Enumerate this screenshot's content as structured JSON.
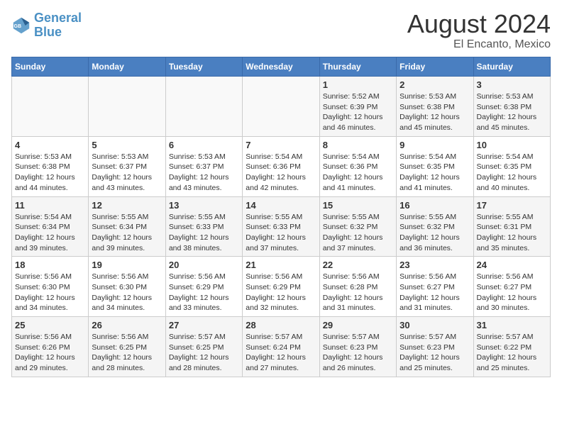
{
  "header": {
    "logo_line1": "General",
    "logo_line2": "Blue",
    "title": "August 2024",
    "subtitle": "El Encanto, Mexico"
  },
  "calendar": {
    "weekdays": [
      "Sunday",
      "Monday",
      "Tuesday",
      "Wednesday",
      "Thursday",
      "Friday",
      "Saturday"
    ],
    "weeks": [
      [
        {
          "day": "",
          "info": ""
        },
        {
          "day": "",
          "info": ""
        },
        {
          "day": "",
          "info": ""
        },
        {
          "day": "",
          "info": ""
        },
        {
          "day": "1",
          "info": "Sunrise: 5:52 AM\nSunset: 6:39 PM\nDaylight: 12 hours\nand 46 minutes."
        },
        {
          "day": "2",
          "info": "Sunrise: 5:53 AM\nSunset: 6:38 PM\nDaylight: 12 hours\nand 45 minutes."
        },
        {
          "day": "3",
          "info": "Sunrise: 5:53 AM\nSunset: 6:38 PM\nDaylight: 12 hours\nand 45 minutes."
        }
      ],
      [
        {
          "day": "4",
          "info": "Sunrise: 5:53 AM\nSunset: 6:38 PM\nDaylight: 12 hours\nand 44 minutes."
        },
        {
          "day": "5",
          "info": "Sunrise: 5:53 AM\nSunset: 6:37 PM\nDaylight: 12 hours\nand 43 minutes."
        },
        {
          "day": "6",
          "info": "Sunrise: 5:53 AM\nSunset: 6:37 PM\nDaylight: 12 hours\nand 43 minutes."
        },
        {
          "day": "7",
          "info": "Sunrise: 5:54 AM\nSunset: 6:36 PM\nDaylight: 12 hours\nand 42 minutes."
        },
        {
          "day": "8",
          "info": "Sunrise: 5:54 AM\nSunset: 6:36 PM\nDaylight: 12 hours\nand 41 minutes."
        },
        {
          "day": "9",
          "info": "Sunrise: 5:54 AM\nSunset: 6:35 PM\nDaylight: 12 hours\nand 41 minutes."
        },
        {
          "day": "10",
          "info": "Sunrise: 5:54 AM\nSunset: 6:35 PM\nDaylight: 12 hours\nand 40 minutes."
        }
      ],
      [
        {
          "day": "11",
          "info": "Sunrise: 5:54 AM\nSunset: 6:34 PM\nDaylight: 12 hours\nand 39 minutes."
        },
        {
          "day": "12",
          "info": "Sunrise: 5:55 AM\nSunset: 6:34 PM\nDaylight: 12 hours\nand 39 minutes."
        },
        {
          "day": "13",
          "info": "Sunrise: 5:55 AM\nSunset: 6:33 PM\nDaylight: 12 hours\nand 38 minutes."
        },
        {
          "day": "14",
          "info": "Sunrise: 5:55 AM\nSunset: 6:33 PM\nDaylight: 12 hours\nand 37 minutes."
        },
        {
          "day": "15",
          "info": "Sunrise: 5:55 AM\nSunset: 6:32 PM\nDaylight: 12 hours\nand 37 minutes."
        },
        {
          "day": "16",
          "info": "Sunrise: 5:55 AM\nSunset: 6:32 PM\nDaylight: 12 hours\nand 36 minutes."
        },
        {
          "day": "17",
          "info": "Sunrise: 5:55 AM\nSunset: 6:31 PM\nDaylight: 12 hours\nand 35 minutes."
        }
      ],
      [
        {
          "day": "18",
          "info": "Sunrise: 5:56 AM\nSunset: 6:30 PM\nDaylight: 12 hours\nand 34 minutes."
        },
        {
          "day": "19",
          "info": "Sunrise: 5:56 AM\nSunset: 6:30 PM\nDaylight: 12 hours\nand 34 minutes."
        },
        {
          "day": "20",
          "info": "Sunrise: 5:56 AM\nSunset: 6:29 PM\nDaylight: 12 hours\nand 33 minutes."
        },
        {
          "day": "21",
          "info": "Sunrise: 5:56 AM\nSunset: 6:29 PM\nDaylight: 12 hours\nand 32 minutes."
        },
        {
          "day": "22",
          "info": "Sunrise: 5:56 AM\nSunset: 6:28 PM\nDaylight: 12 hours\nand 31 minutes."
        },
        {
          "day": "23",
          "info": "Sunrise: 5:56 AM\nSunset: 6:27 PM\nDaylight: 12 hours\nand 31 minutes."
        },
        {
          "day": "24",
          "info": "Sunrise: 5:56 AM\nSunset: 6:27 PM\nDaylight: 12 hours\nand 30 minutes."
        }
      ],
      [
        {
          "day": "25",
          "info": "Sunrise: 5:56 AM\nSunset: 6:26 PM\nDaylight: 12 hours\nand 29 minutes."
        },
        {
          "day": "26",
          "info": "Sunrise: 5:56 AM\nSunset: 6:25 PM\nDaylight: 12 hours\nand 28 minutes."
        },
        {
          "day": "27",
          "info": "Sunrise: 5:57 AM\nSunset: 6:25 PM\nDaylight: 12 hours\nand 28 minutes."
        },
        {
          "day": "28",
          "info": "Sunrise: 5:57 AM\nSunset: 6:24 PM\nDaylight: 12 hours\nand 27 minutes."
        },
        {
          "day": "29",
          "info": "Sunrise: 5:57 AM\nSunset: 6:23 PM\nDaylight: 12 hours\nand 26 minutes."
        },
        {
          "day": "30",
          "info": "Sunrise: 5:57 AM\nSunset: 6:23 PM\nDaylight: 12 hours\nand 25 minutes."
        },
        {
          "day": "31",
          "info": "Sunrise: 5:57 AM\nSunset: 6:22 PM\nDaylight: 12 hours\nand 25 minutes."
        }
      ]
    ]
  }
}
